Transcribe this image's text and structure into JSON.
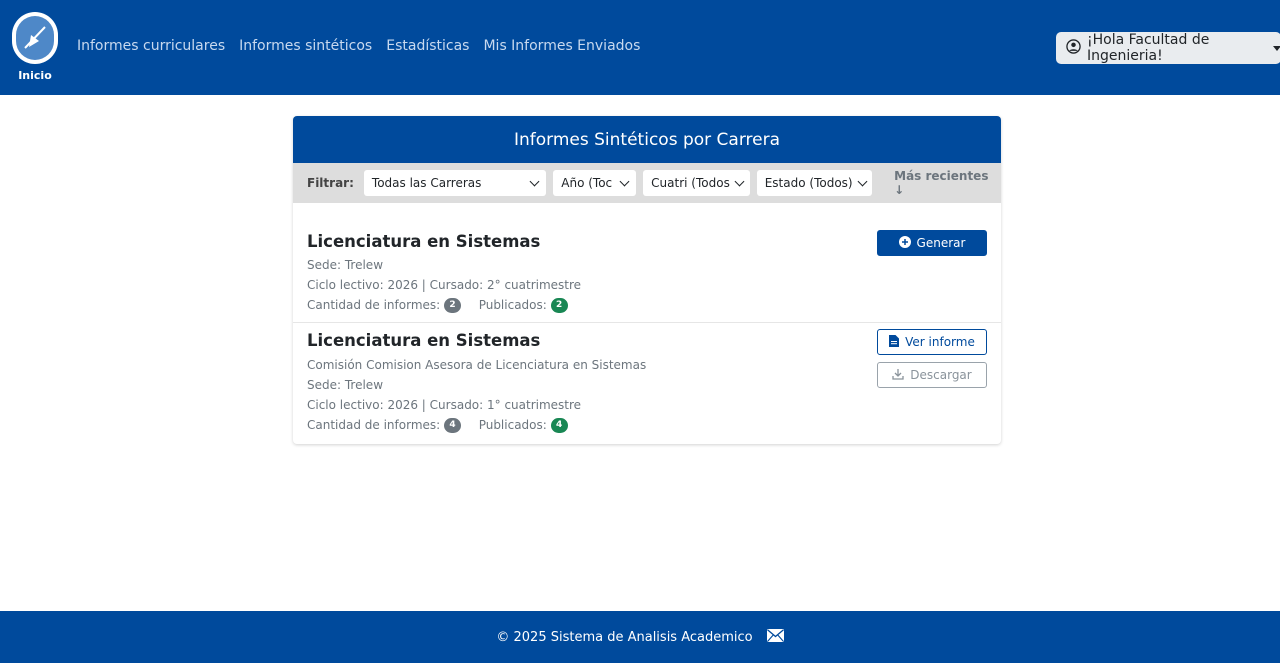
{
  "navbar": {
    "brand_label": "Inicio",
    "links": [
      "Informes curriculares",
      "Informes sintéticos",
      "Estadísticas",
      "Mis Informes Enviados"
    ],
    "user_greeting": "¡Hola Facultad de Ingenieria!"
  },
  "card": {
    "title": "Informes Sintéticos por Carrera",
    "filter": {
      "label": "Filtrar:",
      "carrera": "Todas las Carreras",
      "anio": "Año (Toc",
      "cuatri": "Cuatri (Todos",
      "estado": "Estado (Todos)",
      "sort": "Más recientes ↓"
    },
    "items": [
      {
        "title": "Licenciatura en Sistemas",
        "sede": "Sede: Trelew",
        "ciclo": "Ciclo lectivo: 2026 | Cursado: 2° cuatrimestre",
        "cantidad_label": "Cantidad de informes:",
        "cantidad": "2",
        "publicados_label": "Publicados:",
        "publicados": "2",
        "action": "Generar"
      },
      {
        "title": "Licenciatura en Sistemas",
        "comision": "Comisión Comision Asesora de Licenciatura en Sistemas",
        "sede": "Sede: Trelew",
        "ciclo": "Ciclo lectivo: 2026 | Cursado: 1° cuatrimestre",
        "cantidad_label": "Cantidad de informes:",
        "cantidad": "4",
        "publicados_label": "Publicados:",
        "publicados": "4",
        "action_view": "Ver informe",
        "action_download": "Descargar"
      }
    ]
  },
  "footer": {
    "text": "© 2025 Sistema de Analisis Academico"
  },
  "colors": {
    "primary": "#004a9c",
    "success": "#198754",
    "secondary": "#6c757d"
  },
  "icons": [
    "compass-logo-icon",
    "user-circle-icon",
    "plus-circle-icon",
    "file-icon",
    "download-icon",
    "envelope-icon"
  ]
}
